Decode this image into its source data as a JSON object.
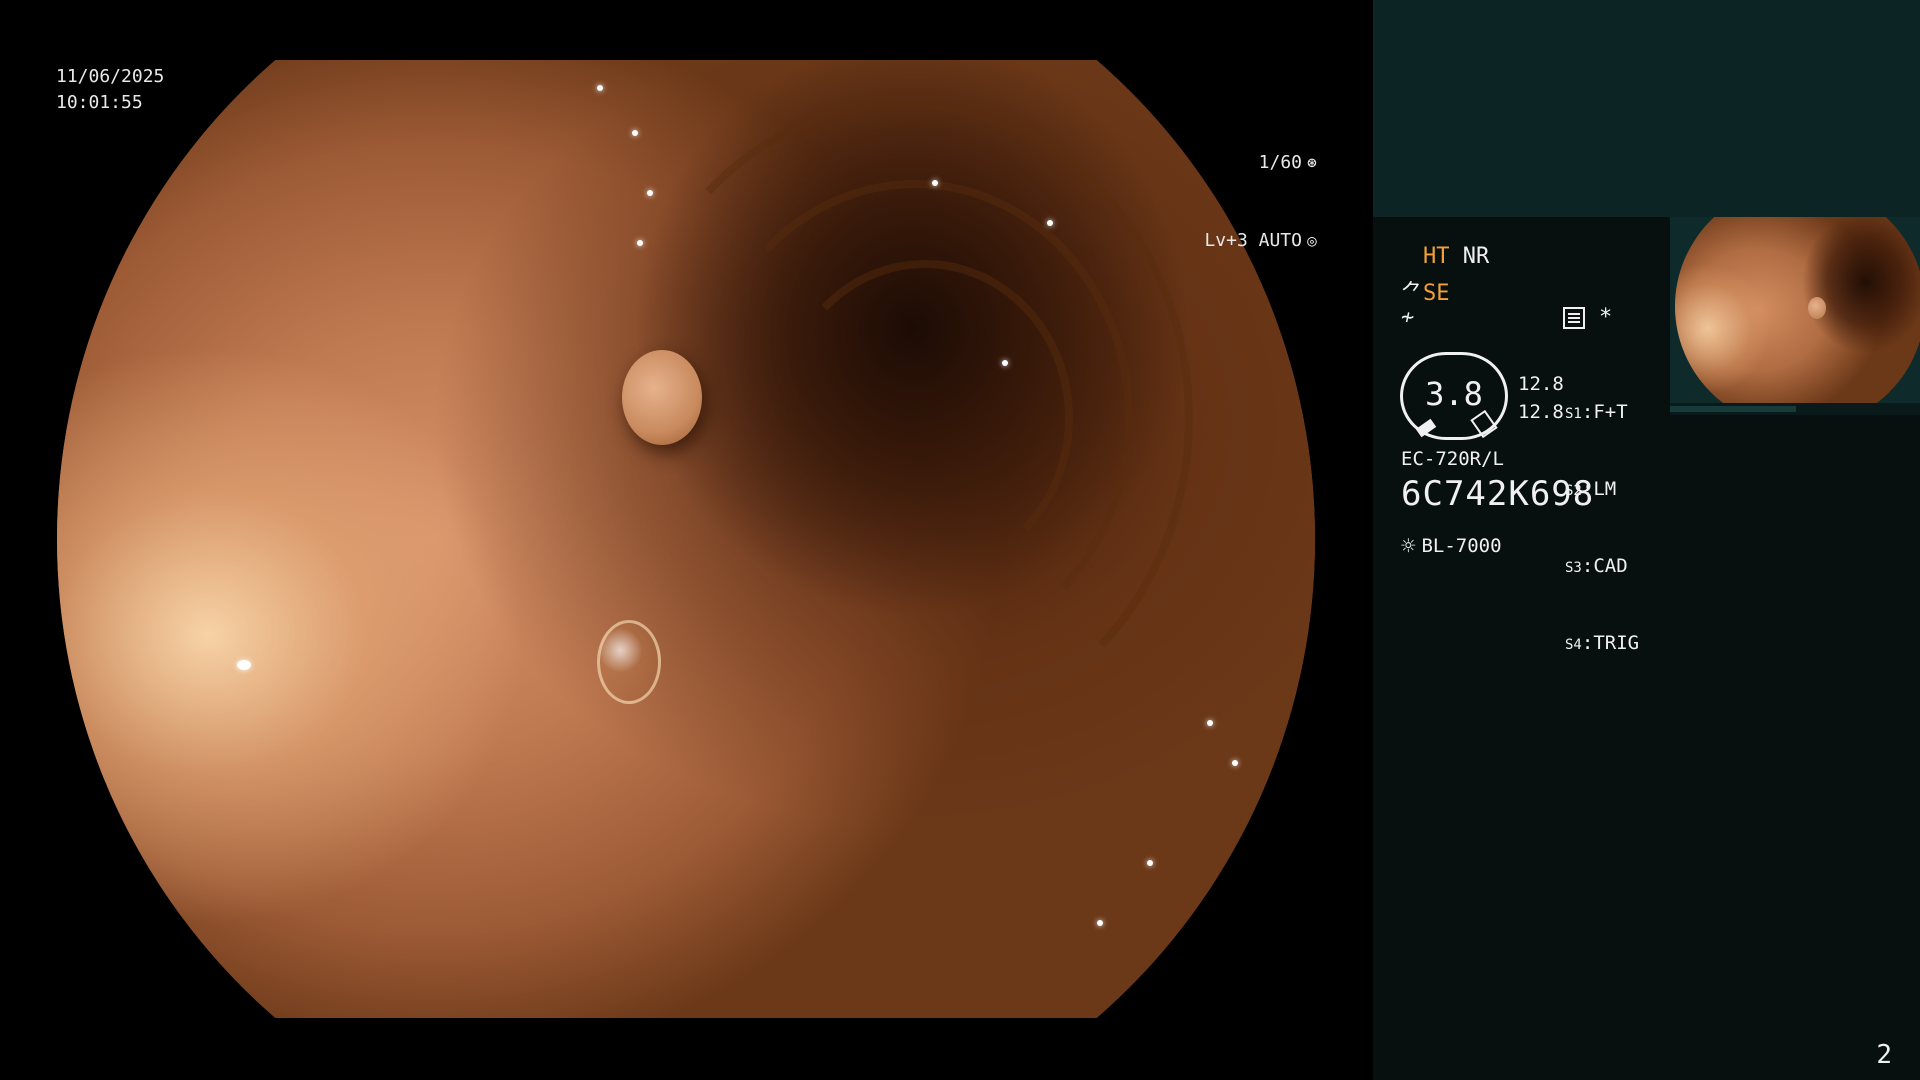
{
  "osd": {
    "date": "11/06/2025",
    "time": "10:01:55",
    "shutter": "1/60",
    "shutter_icon": "aperture-icon",
    "iris": "Lv+3 AUTO",
    "iris_icon": "iris-icon"
  },
  "panel": {
    "mode_ht": "HT",
    "mode_nr": "NR",
    "mode_se": "SE",
    "mode_se_icon": "structure-enhance-icon",
    "mode_flow_icon": "flow-icon",
    "list_icon": "settings-list-icon",
    "asterisk": "*",
    "gauge_value": "3.8",
    "readout_1": "12.8",
    "readout_2": "12.8",
    "settings": [
      {
        "label": "S1",
        "value": "F+T"
      },
      {
        "label": "S2",
        "value": "LM"
      },
      {
        "label": "S3",
        "value": "CAD"
      },
      {
        "label": "S4",
        "value": "TRIG"
      }
    ],
    "scope_model": "EC-720R/L",
    "scope_serial": "6C742K698",
    "light_source": "BL-7000",
    "light_icon": "sun-icon",
    "page_number": "2"
  },
  "colors": {
    "panel_bg": "#07100f",
    "panel_top": "#0d2424",
    "accent_orange": "#f2a13a",
    "text": "#f0f0f0"
  }
}
